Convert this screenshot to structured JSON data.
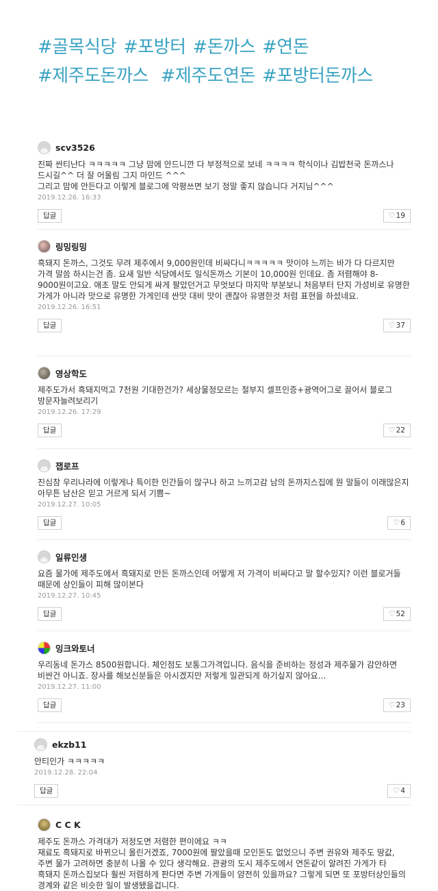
{
  "tags": [
    "#골목식당",
    "#포방터",
    "#돈까스",
    "#연돈",
    "#제주도돈까스",
    "#제주도연돈",
    "#포방터돈까스"
  ],
  "reply_label": "답글",
  "comments": [
    {
      "nick": "scv3526",
      "avatar": "default",
      "text": "진짜 싼티난다 ㅋㅋㅋㅋㅋ 그냥 맘에 안드니깐 다 부정적으로 보네 ㅋㅋㅋㅋ 학식이나 김밥천국 돈까스나 드시길^^ 더 잘 어울림 그지 마인드 ^^^\n그리고 맘에 안든다고 이렇게 블로그에 악평쓰면 보기 정말 좋지 않습니다 거지님^^^",
      "date": "2019.12.26. 16:33",
      "likes": "19"
    },
    {
      "nick": "링밍링밍",
      "avatar": "photo1",
      "text": "흑돼지 돈까스, 그것도 무려 제주에서 9,000원인데 비싸다니ㅋㅋㅋㅋㅋ 맛이야 느끼는 바가 다 다르지만 가격 말씀 하시는건 좀. 요새 일반 식당에서도 일식돈까스 기본이 10,000원 인데요. 좀 저렴해야 8-9000원이고요. 애초 말도 안되게 싸게 팔았던거고 무엇보다 마지막 부분보니 처음부터 단지 가성비로 유명한 가게가 아니라 맛으로 유명한 가게인데 싼맛 대비 맛이 괜찮아 유명한것 처럼 표현을 하셨네요.",
      "date": "2019.12.26. 16:51",
      "likes": "37"
    },
    {
      "nick": "영상학도",
      "avatar": "photo2",
      "text": "제주도가서 흑돼지먹고 7천원 기대한건가? 세상물정모르는 철부지 셀프인증+광역어그로 끌어서 블로그 방문자늘려보리기",
      "date": "2019.12.26. 17:29",
      "likes": "22"
    },
    {
      "nick": "잽로프",
      "avatar": "default",
      "text": "진심참 우리나라에 이렇게나 특이한 인간들이 많구나 하고 느끼고감 남의 돈까지스집에 뭔 말들이 이래많은지 아무튼 남산은 믿고 거르게 되서 기쁨~",
      "date": "2019.12.27. 10:05",
      "likes": "6"
    },
    {
      "nick": "일류인생",
      "avatar": "default",
      "text": "요즘 물가에 제주도에서 흑돼지로 만든 돈까스인데 어떻게 저 가격이 비싸다고 말 할수있지? 이런 블로거들 때문에 상인들이 피해 많이본다",
      "date": "2019.12.27. 10:45",
      "likes": "52"
    },
    {
      "nick": "잉크와토너",
      "avatar": "photo3",
      "text": "우리동네 돈가스 8500원합니다. 체인점도 보통그가격입니다. 음식을 준비하는 정성과 제주물가 감안하면 비싼건 아니죠. 장사를 해보신분들은 아시겠지만 저렇게 일관되게 하기싶지 않아요...",
      "date": "2019.12.27. 11:00",
      "likes": "23"
    },
    {
      "nick": "ekzb11",
      "avatar": "default",
      "text": "안티인가 ㅋㅋㅋㅋㅋ",
      "date": "2019.12.28. 22:04",
      "likes": "4"
    },
    {
      "nick": "C C K",
      "avatar": "photo4",
      "text": "제주도 돈까스 가격대가 저정도면 저렴한 편이에요 ㅋㅋ\n재료도 흑돼지로 바뀌으니 올린거겠죠, 7000원에 팔았을때 모인돈도 없었으니 주변 권유와 제주도 땅값, 주변 물가 고려하면 충분히 나올 수 있다 생각해요. 관광의 도시 제주도에서 연돈같이 알려진 가게가 타 흑돼지 돈까스집보다 훨씬 저렴하게 판다면 주변 가게들이 얌전히 있을까요? 그렇게 되면 또 포방터상인들의 경계와 같은 비슷한 일이 발생됐을겁니다.",
      "date": "",
      "likes": ""
    }
  ]
}
